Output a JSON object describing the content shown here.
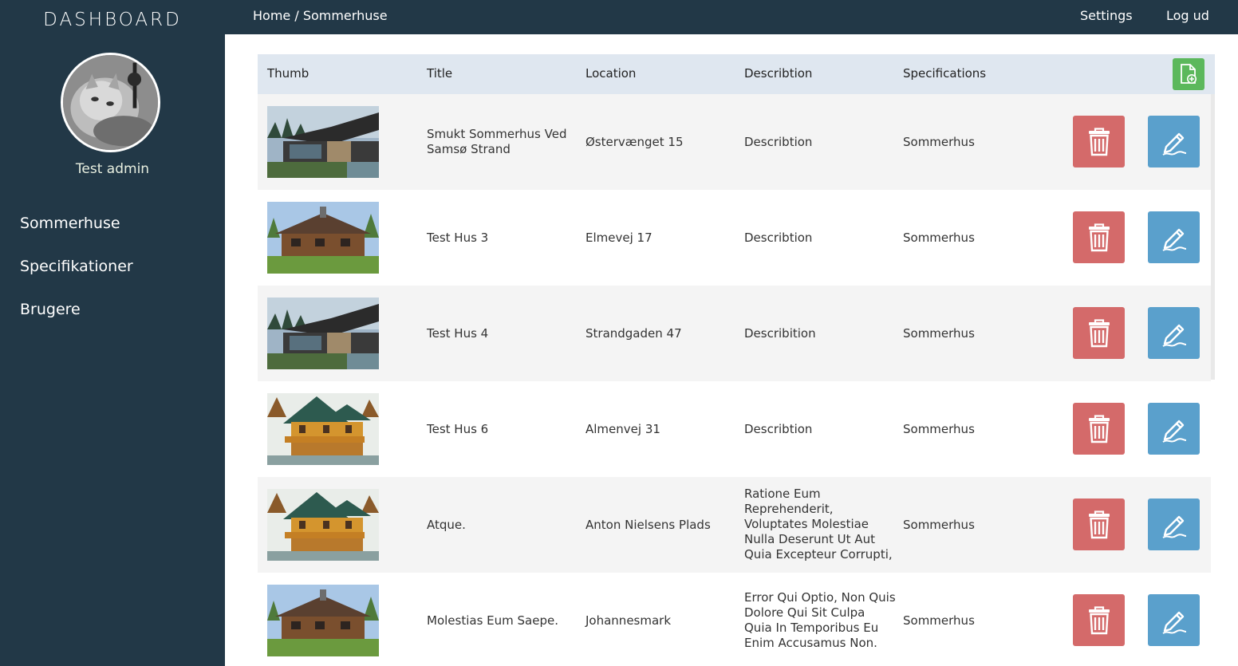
{
  "sidebar": {
    "brand": "DASHBOARD",
    "admin_name": "Test admin",
    "items": [
      {
        "label": "Sommerhuse"
      },
      {
        "label": "Specifikationer"
      },
      {
        "label": "Brugere"
      }
    ]
  },
  "topbar": {
    "breadcrumb_home": "Home",
    "breadcrumb_sep": " / ",
    "breadcrumb_current": "Sommerhuse",
    "settings": "Settings",
    "logout": "Log ud"
  },
  "table": {
    "headers": {
      "thumb": "Thumb",
      "title": "Title",
      "location": "Location",
      "description": "Describtion",
      "specifications": "Specifications"
    },
    "rows": [
      {
        "thumb": "modern-house",
        "title": "Smukt Sommerhus Ved Samsø Strand",
        "location": "Østervænget 15",
        "description": "Describtion",
        "specification": "Sommerhus"
      },
      {
        "thumb": "log-cabin",
        "title": "Test Hus 3",
        "location": "Elmevej 17",
        "description": "Describtion",
        "specification": "Sommerhus"
      },
      {
        "thumb": "modern-house",
        "title": "Test Hus 4",
        "location": "Strandgaden 47",
        "description": "Describition",
        "specification": "Sommerhus"
      },
      {
        "thumb": "timber-lodge",
        "title": "Test Hus 6",
        "location": "Almenvej 31",
        "description": "Describtion",
        "specification": "Sommerhus"
      },
      {
        "thumb": "timber-lodge",
        "title": "Atque.",
        "location": "Anton Nielsens Plads",
        "description": "Ratione Eum Reprehenderit, Voluptates Molestiae Nulla Deserunt Ut Aut Quia Excepteur Corrupti, Qui Qui",
        "specification": "Sommerhus"
      },
      {
        "thumb": "log-cabin",
        "title": "Molestias Eum Saepe.",
        "location": "Johannesmark",
        "description": "Error Qui Optio, Non Quis Dolore Qui Sit Culpa Quia In Temporibus Eu Enim Accusamus Non.",
        "specification": "Sommerhus"
      }
    ]
  },
  "icons": {
    "add": "file-add-icon",
    "delete": "trash-icon",
    "edit": "pencil-icon"
  },
  "colors": {
    "sidebar_bg": "#223847",
    "header_bg": "#dfe7f0",
    "add_button": "#5cb85c",
    "delete_button": "#d46a6a",
    "edit_button": "#5aa0cc"
  }
}
